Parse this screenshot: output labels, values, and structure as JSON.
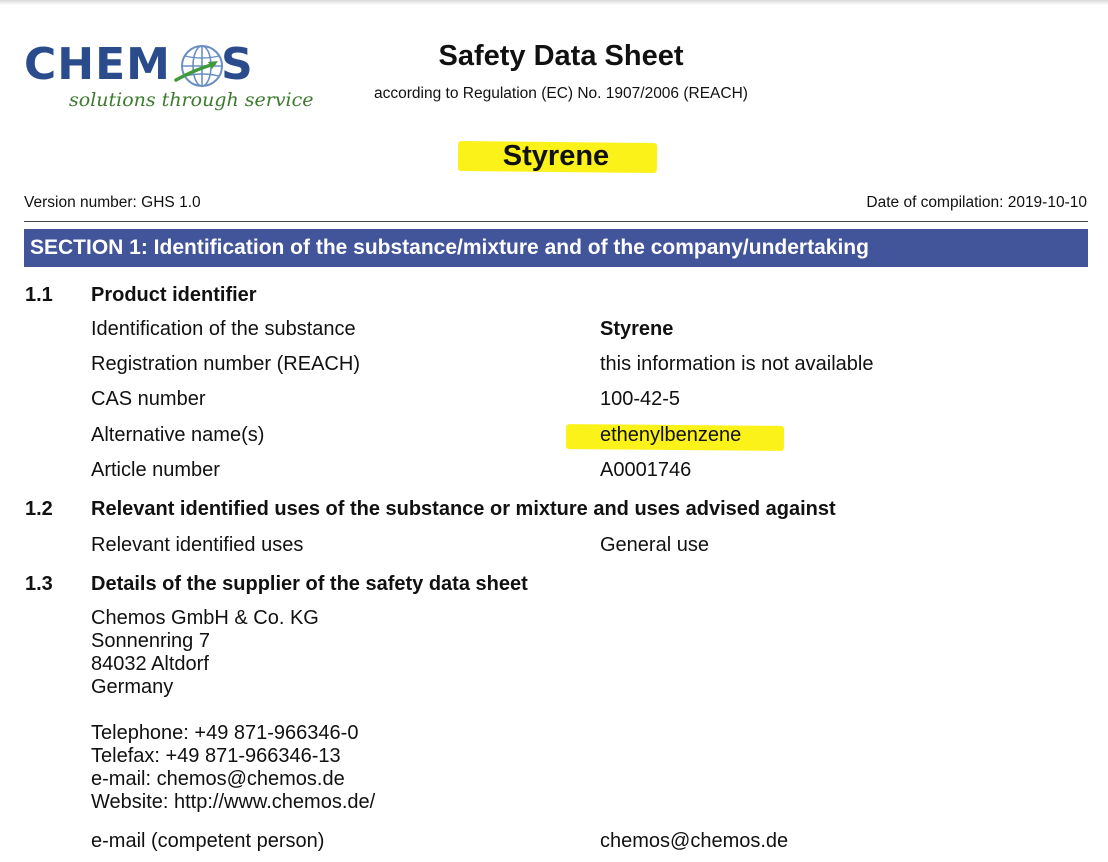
{
  "logo": {
    "word_left": "CHEM",
    "word_right": "S",
    "tagline": "solutions through service"
  },
  "header": {
    "title": "Safety Data Sheet",
    "subtitle": "according to Regulation (EC) No. 1907/2006 (REACH)"
  },
  "product_name": "Styrene",
  "meta": {
    "version": "Version number: GHS 1.0",
    "date": "Date of compilation: 2019-10-10"
  },
  "section": {
    "title": "SECTION 1: Identification of the substance/mixture and of the company/undertaking",
    "s1_1": {
      "number": "1.1",
      "heading": "Product identifier",
      "rows": [
        {
          "label": "Identification of the substance",
          "value": "Styrene"
        },
        {
          "label": "Registration number (REACH)",
          "value": "this information is not available"
        },
        {
          "label": "CAS number",
          "value": "100-42-5"
        },
        {
          "label": "Alternative name(s)",
          "value": "ethenylbenzene"
        },
        {
          "label": "Article number",
          "value": "A0001746"
        }
      ]
    },
    "s1_2": {
      "number": "1.2",
      "heading": "Relevant identified uses of the substance or mixture and uses advised against",
      "rows": [
        {
          "label": "Relevant identified uses",
          "value": "General use"
        }
      ]
    },
    "s1_3": {
      "number": "1.3",
      "heading": "Details of the supplier of the safety data sheet",
      "address": [
        "Chemos GmbH & Co. KG",
        "Sonnenring 7",
        "84032 Altdorf",
        "Germany"
      ],
      "contact": [
        "Telephone: +49 871-966346-0",
        "Telefax: +49 871-966346-13",
        "e-mail: chemos@chemos.de",
        "Website: http://www.chemos.de/"
      ],
      "competent": {
        "label": "e-mail (competent person)",
        "value": "chemos@chemos.de"
      }
    }
  },
  "colors": {
    "section_bar": "#42549a",
    "highlight": "#fbf21a",
    "logo_blue": "#2a4c8c",
    "logo_green": "#3c7a2e"
  }
}
